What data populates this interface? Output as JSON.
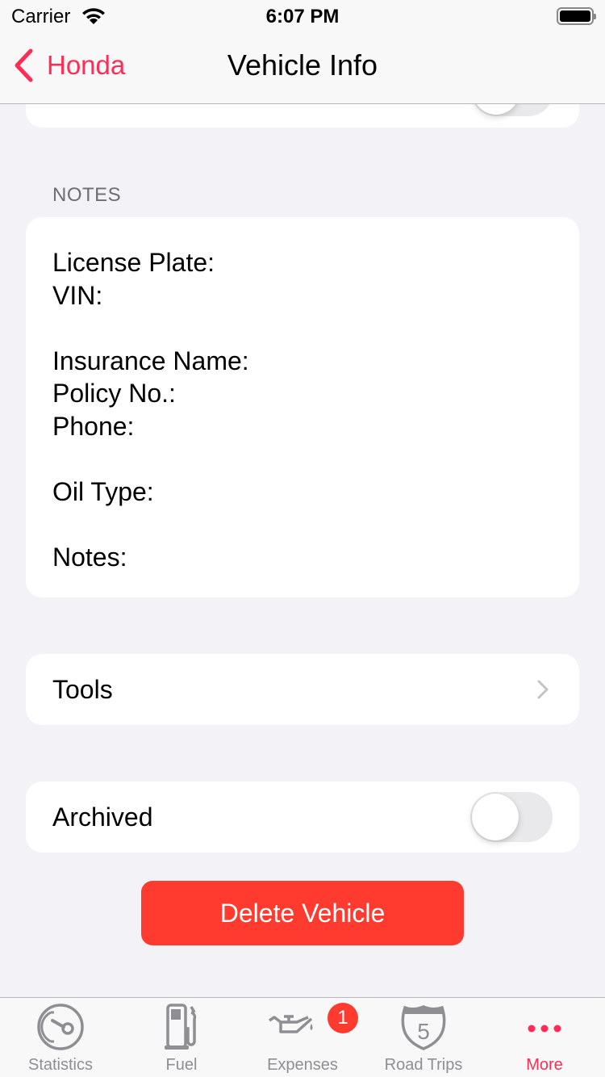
{
  "status_bar": {
    "carrier": "Carrier",
    "time": "6:07 PM",
    "battery_level": 1.0
  },
  "nav": {
    "back_label": "Honda",
    "title": "Vehicle Info"
  },
  "top_row": {
    "toggle_on": false
  },
  "notes": {
    "header": "NOTES",
    "lines": [
      "License Plate:",
      "VIN:",
      "",
      "Insurance Name:",
      "Policy No.:",
      "Phone:",
      "",
      "Oil Type:",
      "",
      "Notes:"
    ]
  },
  "tools": {
    "label": "Tools"
  },
  "archived": {
    "label": "Archived",
    "toggle_on": false
  },
  "delete_button": {
    "label": "Delete Vehicle"
  },
  "colors": {
    "accent": "#ff2d55",
    "destructive": "#ff3b30",
    "inactive_tab": "#8e8e93",
    "background": "#f2f2f7"
  },
  "tab_bar": {
    "items": [
      {
        "label": "Statistics",
        "icon": "gauge-icon",
        "active": false
      },
      {
        "label": "Fuel",
        "icon": "fuel-pump-icon",
        "active": false
      },
      {
        "label": "Expenses",
        "icon": "oil-can-icon",
        "active": false,
        "badge": "1"
      },
      {
        "label": "Road Trips",
        "icon": "interstate-shield-icon",
        "active": false
      },
      {
        "label": "More",
        "icon": "more-dots-icon",
        "active": true
      }
    ]
  }
}
